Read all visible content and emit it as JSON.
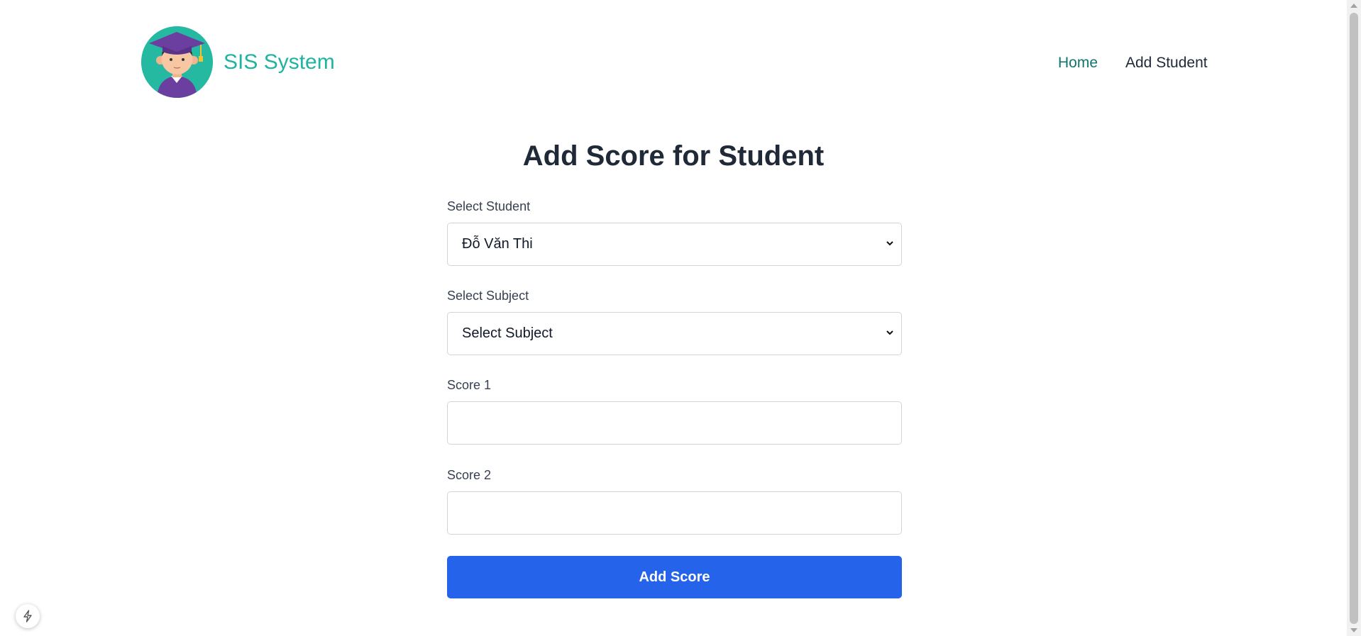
{
  "header": {
    "brand_name": "SIS System",
    "logo_icon": "student-graduate-avatar-icon",
    "nav": [
      {
        "label": "Home",
        "active": true
      },
      {
        "label": "Add Student",
        "active": false
      }
    ]
  },
  "main": {
    "title": "Add Score for Student",
    "fields": {
      "student": {
        "label": "Select Student",
        "value": "Đỗ Văn Thi"
      },
      "subject": {
        "label": "Select Subject",
        "value": "Select Subject"
      },
      "score1": {
        "label": "Score 1",
        "value": ""
      },
      "score2": {
        "label": "Score 2",
        "value": ""
      }
    },
    "submit_label": "Add Score"
  },
  "colors": {
    "brand": "#1fb3a0",
    "nav_active": "#0f766e",
    "primary_button": "#2563eb"
  },
  "floating_icon": "lightning-bolt-icon"
}
